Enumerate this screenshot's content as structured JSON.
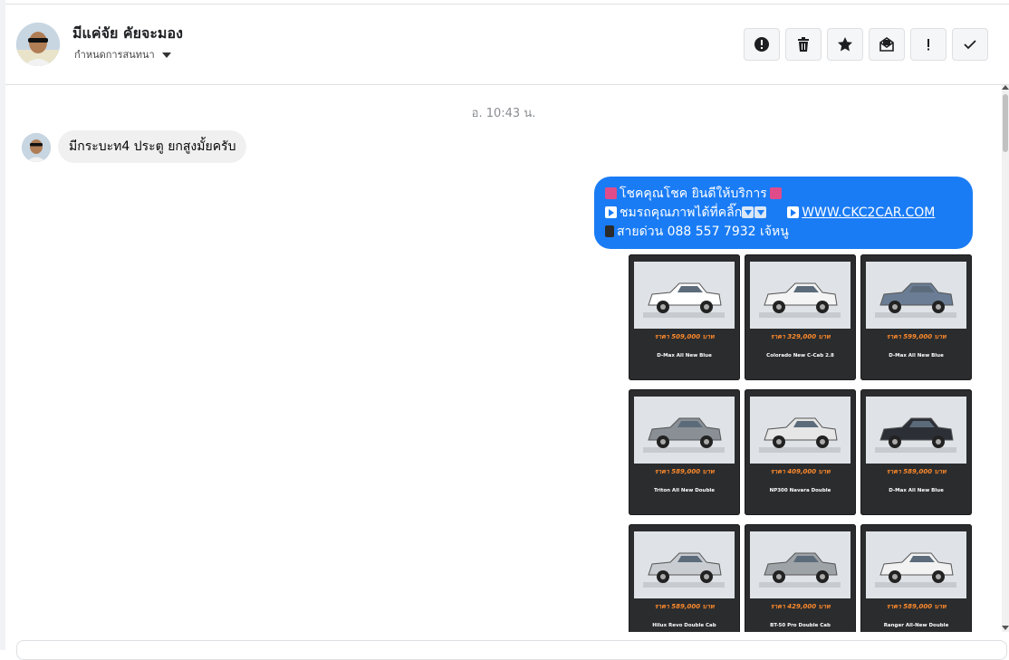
{
  "header": {
    "contact_name": "มีแค่จัย คัยจะมอง",
    "conversation_settings": "กำหนดการสนทนา"
  },
  "chat": {
    "timestamp": "อ. 10:43 น.",
    "incoming_message": "มีกระบะท4 ประตู ยกสูงมั้ยครับ",
    "outgoing": {
      "line1": "โชคคุณโชค ยินดีให้บริการ",
      "line2": "ชมรถคุณภาพได้ที่คลิ๊ก",
      "link": "WWW.CKC2CAR.COM",
      "line3": "สายด่วน 088 557 7932 เจ้หนู"
    }
  },
  "cars": [
    {
      "price": "ราคา 509,000 บาท",
      "model": "D-Max All New Blue",
      "color": "#ffffff"
    },
    {
      "price": "ราคา 329,000 บาท",
      "model": "Colorado New C-Cab 2.8",
      "color": "#f4f4f4"
    },
    {
      "price": "ราคา 599,000 บาท",
      "model": "D-Max All New Blue",
      "color": "#6b7d95"
    },
    {
      "price": "ราคา 589,000 บาท",
      "model": "Triton All New Double",
      "color": "#8a8f96"
    },
    {
      "price": "ราคา 409,000 บาท",
      "model": "NP300 Navara Double",
      "color": "#e6e6e6"
    },
    {
      "price": "ราคา 589,000 บาท",
      "model": "D-Max All New Blue",
      "color": "#2c2f36"
    },
    {
      "price": "ราคา 589,000 บาท",
      "model": "Hilux Revo Double Cab",
      "color": "#c9cdd2"
    },
    {
      "price": "ราคา 429,000 บาท",
      "model": "BT-50 Pro Double Cab",
      "color": "#9ea3a8"
    },
    {
      "price": "ราคา 589,000 บาท",
      "model": "Ranger All-New Double",
      "color": "#f2f2f2"
    }
  ]
}
